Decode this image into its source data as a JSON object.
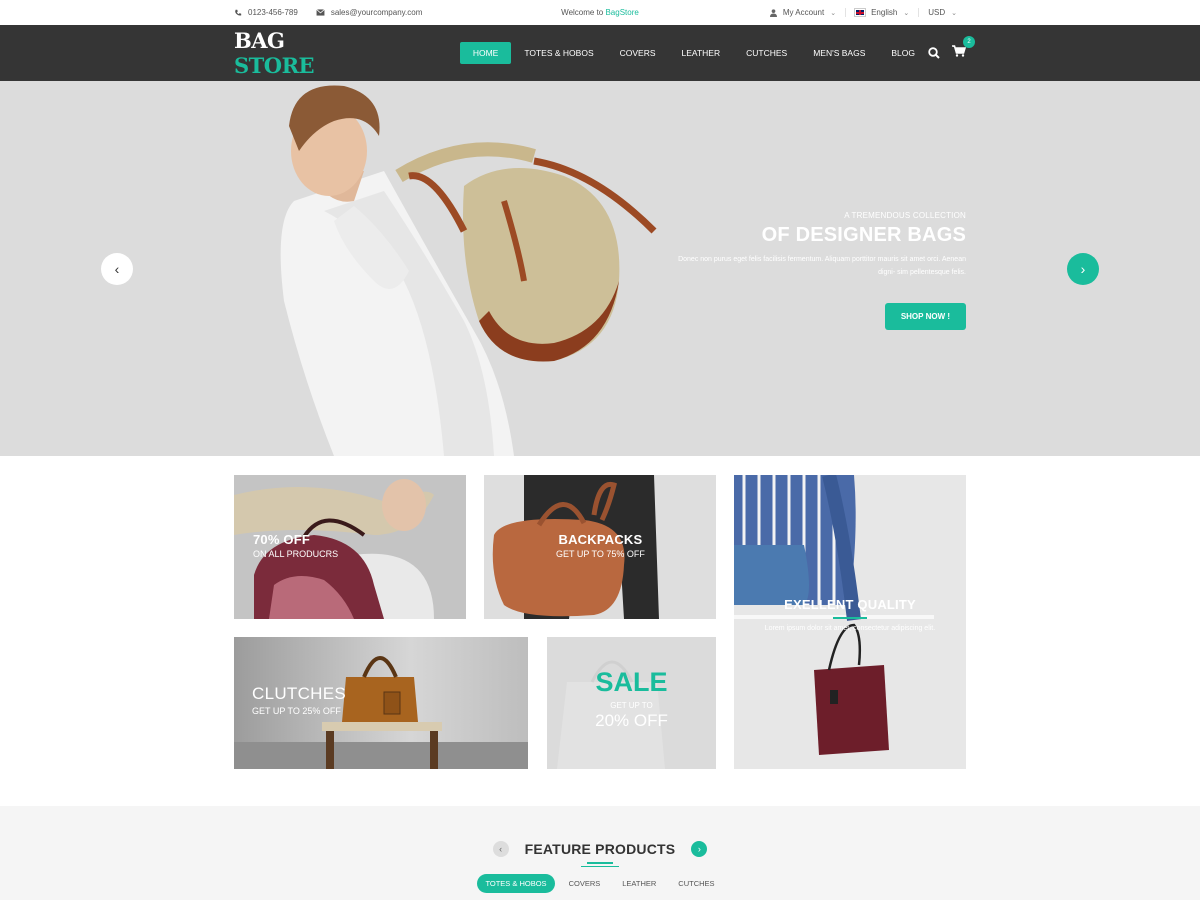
{
  "topbar": {
    "phone": "0123-456-789",
    "email": "sales@yourcompany.com",
    "welcome_prefix": "Welcome to ",
    "welcome_brand": "BagStore",
    "account": "My Account",
    "language": "English",
    "currency": "USD"
  },
  "header": {
    "logo_main": "BAG",
    "logo_accent": "STORE",
    "nav": [
      "HOME",
      "TOTES & HOBOS",
      "COVERS",
      "LEATHER",
      "CUTCHES",
      "MEN'S BAGS",
      "BLOG"
    ],
    "cart_count": "2"
  },
  "hero": {
    "subtitle": "A TREMENDOUS COLLECTION",
    "title": "OF DESIGNER BAGS",
    "description": "Donec non purus eget felis facilisis fermentum. Aliquam porttitor mauris sit amet orci. Aenean digni- sim pellentesque felis.",
    "button": "SHOP NOW !"
  },
  "banners": {
    "off": {
      "big": "70% OFF",
      "small": "ON ALL PRODUCRS"
    },
    "backpacks": {
      "big": "BACKPACKS",
      "small": "GET UP TO 75% OFF"
    },
    "quality": {
      "big": "EXELLENT QUALITY",
      "small": "Lorem ipsum dolor sit amet, consectetur adipiscing elit."
    },
    "clutches": {
      "big": "CLUTCHES",
      "small": "GET UP TO 25% OFF"
    },
    "sale": {
      "big": "SALE",
      "small": "GET UP TO",
      "off": "20% OFF"
    }
  },
  "features": {
    "title": "FEATURE PRODUCTS",
    "tabs": [
      "TOTES & HOBOS",
      "COVERS",
      "LEATHER",
      "CUTCHES"
    ]
  },
  "colors": {
    "accent": "#1abc9c",
    "header_bg": "#353535"
  }
}
